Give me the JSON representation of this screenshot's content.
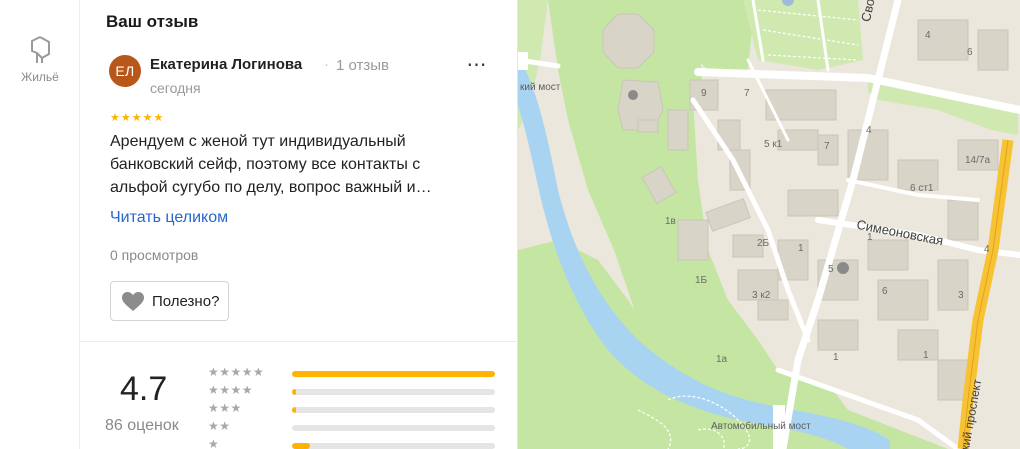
{
  "sidebar": {
    "items": [
      {
        "label": "Жильё",
        "icon": "housing-icon"
      }
    ]
  },
  "review_panel": {
    "title": "Ваш отзыв",
    "review": {
      "avatar_initials": "ЕЛ",
      "avatar_color": "#b9561a",
      "author": "Екатерина Логинова",
      "author_reviews": "1 отзыв",
      "date": "сегодня",
      "rating": 5,
      "text": "Арендуем с женой тут индивидуальный банковский сейф, поэтому все контакты с альфой сугубо по делу, вопрос важный и…",
      "read_more": "Читать целиком",
      "views": "0 просмотров",
      "helpful_label": "Полезно?"
    },
    "summary": {
      "rating": "4.7",
      "count": "86 оценок",
      "distribution": [
        {
          "stars": 5,
          "fraction": 1.0
        },
        {
          "stars": 4,
          "fraction": 0.02
        },
        {
          "stars": 3,
          "fraction": 0.02
        },
        {
          "stars": 2,
          "fraction": 0.0
        },
        {
          "stars": 1,
          "fraction": 0.09
        }
      ]
    }
  },
  "map": {
    "labels": {
      "bridge_top": "кий мост",
      "bridge_bottom": "Автомобильный мост",
      "street_simeonovskaya": "Симеоновская",
      "street_svoboda": "Свобод",
      "street_prospekt": "кий проспект"
    },
    "building_numbers": [
      "4",
      "6",
      "9",
      "7",
      "5 к1",
      "7",
      "4",
      "14/7а",
      "6 ст1",
      "1в",
      "2Б",
      "1",
      "5",
      "1Б",
      "3 к2",
      "1",
      "6",
      "3",
      "1",
      "1а",
      "1",
      "4"
    ],
    "colors": {
      "water": "#a8d4f2",
      "park": "#c4e6a2",
      "road_main": "#f7c233",
      "road": "#ffffff",
      "land": "#ebe7dd"
    }
  },
  "colors": {
    "accent_yellow": "#ffb200",
    "link_blue": "#2867c9"
  }
}
